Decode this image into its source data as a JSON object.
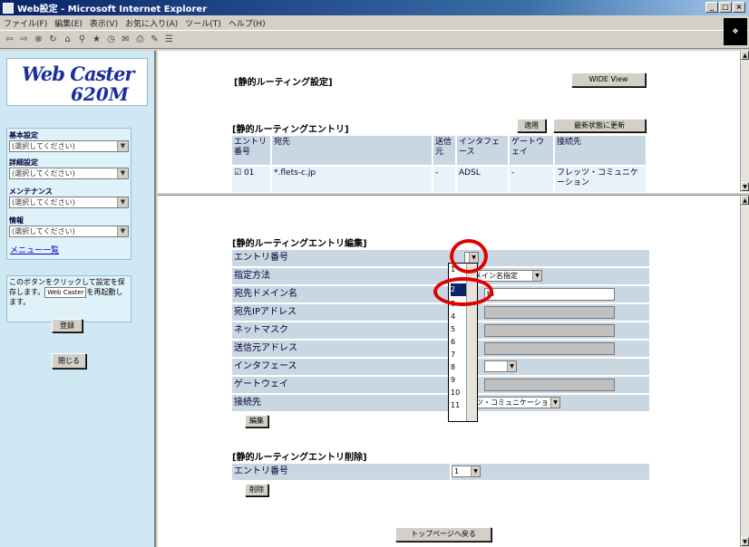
{
  "window": {
    "title": "Web設定 - Microsoft Internet Explorer",
    "menu": [
      "ファイル(F)",
      "編集(E)",
      "表示(V)",
      "お気に入り(A)",
      "ツール(T)",
      "ヘルプ(H)"
    ]
  },
  "left": {
    "logo_line1": "Web Caster",
    "logo_line2": "620M",
    "nav_groups": [
      {
        "label": "基本設定",
        "select": "(選択してください)"
      },
      {
        "label": "詳細設定",
        "select": "(選択してください)"
      },
      {
        "label": "メンテナンス",
        "select": "(選択してください)"
      },
      {
        "label": "情報",
        "select": "(選択してください)"
      }
    ],
    "menu_list_link": "メニュー一覧",
    "note_text_a": "このボタンをクリックして設定を保存します。",
    "note_inline": "Web Caster",
    "note_text_b": "を再起動します。",
    "save_button": "登録",
    "close_button": "閉じる"
  },
  "top": {
    "page_title": "[静的ルーティング設定]",
    "wide_view_button": "WIDE View",
    "entry_title": "[静的ルーティングエントリ]",
    "apply_button": "適用",
    "refresh_button": "最新状態に更新",
    "table_headers": [
      "エントリ番号",
      "宛先",
      "送信元",
      "インタフェース",
      "ゲートウェイ",
      "接続先"
    ],
    "row": {
      "checkbox": "☑",
      "number": "01",
      "destination": "*.flets-c.jp",
      "source": "-",
      "interface": "ADSL",
      "gateway": "-",
      "connection": "フレッツ・コミュニケーション"
    }
  },
  "edit": {
    "title": "[静的ルーティングエントリ編集]",
    "labels": [
      "エントリ番号",
      "指定方法",
      "宛先ドメイン名",
      "宛先IPアドレス",
      "ネットマスク",
      "送信元アドレス",
      "インタフェース",
      "ゲートウェイ",
      "接続先"
    ],
    "spec_method_value": "ドメイン名指定",
    "domain_partial": "ta",
    "connection_value": "フレッツ・コミュニケーション",
    "edit_button": "編集",
    "dropdown_items": [
      "1",
      "2",
      "3",
      "4",
      "5",
      "6",
      "7",
      "8",
      "9",
      "10",
      "11"
    ]
  },
  "delete": {
    "title": "[静的ルーティングエントリ削除]",
    "label": "エントリ番号",
    "select_value": "1",
    "delete_button": "削除"
  },
  "footer": {
    "top_page_button": "トップページへ戻る"
  }
}
